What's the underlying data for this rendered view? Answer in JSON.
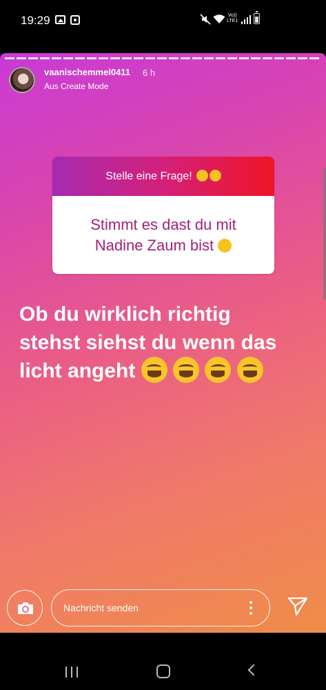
{
  "status_bar": {
    "time": "19:29",
    "volte_line1": "Vo))",
    "volte_line2": "LTE1"
  },
  "story": {
    "username": "vaanischemmel0411",
    "posted_ago": "6 h",
    "source_label": "Aus Create Mode",
    "question_sticker": {
      "prompt": "Stelle eine Frage!",
      "question_line1": "Stimmt es dast du mit",
      "question_line2": "Nadine Zaum bist"
    },
    "caption_line1": "Ob du wirklich richtig",
    "caption_line2": "stehst siehst du wenn das",
    "caption_line3": "licht angeht"
  },
  "reply_bar": {
    "message_placeholder": "Nachricht senden"
  },
  "icons": {
    "camera": "camera-icon",
    "send": "send-icon",
    "more": "more-vertical-icon"
  },
  "colors": {
    "gradient_top": "#c93ad6",
    "gradient_bottom": "#ef8d48",
    "question_text": "#a3217a",
    "sticker_header_start": "#a62bb0",
    "sticker_header_end": "#ee1526"
  }
}
